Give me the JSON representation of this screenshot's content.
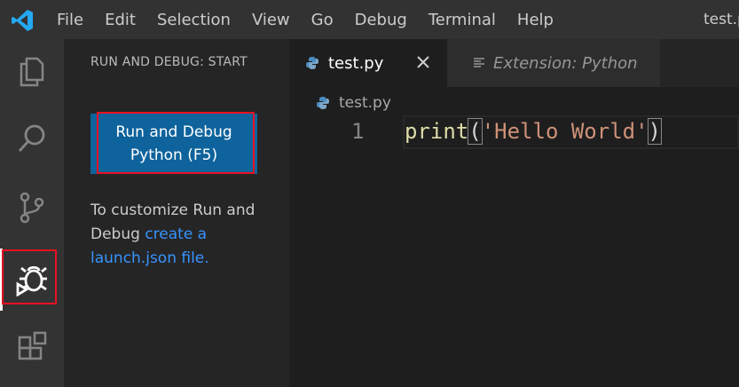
{
  "titlebar": {
    "menu": [
      "File",
      "Edit",
      "Selection",
      "View",
      "Go",
      "Debug",
      "Terminal",
      "Help"
    ],
    "window_title": "test.py"
  },
  "activitybar": {
    "items": [
      "explorer-icon",
      "search-icon",
      "source-control-icon",
      "debug-icon",
      "extensions-icon"
    ],
    "active": "debug-icon"
  },
  "sidebar": {
    "title": "RUN AND DEBUG: START",
    "run_button_label": "Run and Debug Python (F5)",
    "hint_text": "To customize Run and Debug",
    "hint_link": "create a launch.json file."
  },
  "editor": {
    "tabs": [
      {
        "label": "test.py",
        "active": true
      },
      {
        "label": "Extension: Python",
        "active": false
      }
    ],
    "breadcrumb": "test.py",
    "lines": [
      {
        "number": "1",
        "fn": "print",
        "open": "(",
        "string": "'Hello World'",
        "close": ")"
      }
    ]
  },
  "colors": {
    "accent": "#0e639c",
    "highlight_box": "#e81123",
    "link": "#3794ff"
  }
}
